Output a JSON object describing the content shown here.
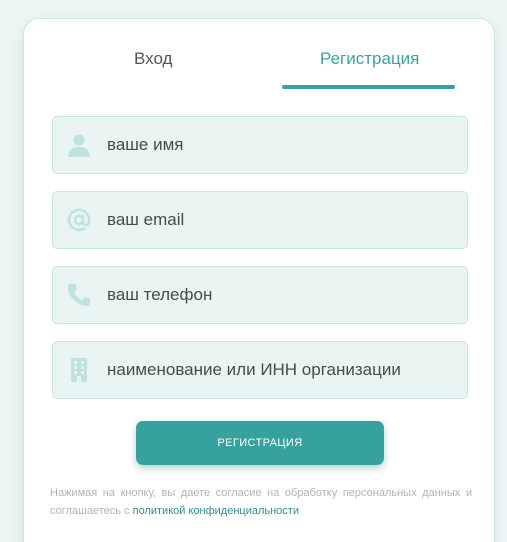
{
  "tabs": {
    "login_label": "Вход",
    "register_label": "Регистрация",
    "active": "register"
  },
  "form": {
    "name_placeholder": "ваше имя",
    "email_placeholder": "ваш email",
    "phone_placeholder": "ваш телефон",
    "org_placeholder": "наименование или ИНН организации"
  },
  "submit_label": "РЕГИСТРАЦИЯ",
  "consent": {
    "text": "Нажимая на кнопку, вы даете согласие на обработку персональных данных и соглашаетесь с ",
    "link": "политикой конфиденциальности"
  },
  "icons": {
    "name": "user-icon",
    "email": "at-sign-icon",
    "phone": "phone-icon",
    "org": "building-icon"
  },
  "colors": {
    "accent": "#37a29d",
    "field_bg": "#eaf4f3",
    "icon": "#bfe2df",
    "muted_text": "#b3b3b3",
    "link": "#2f8f8a"
  }
}
